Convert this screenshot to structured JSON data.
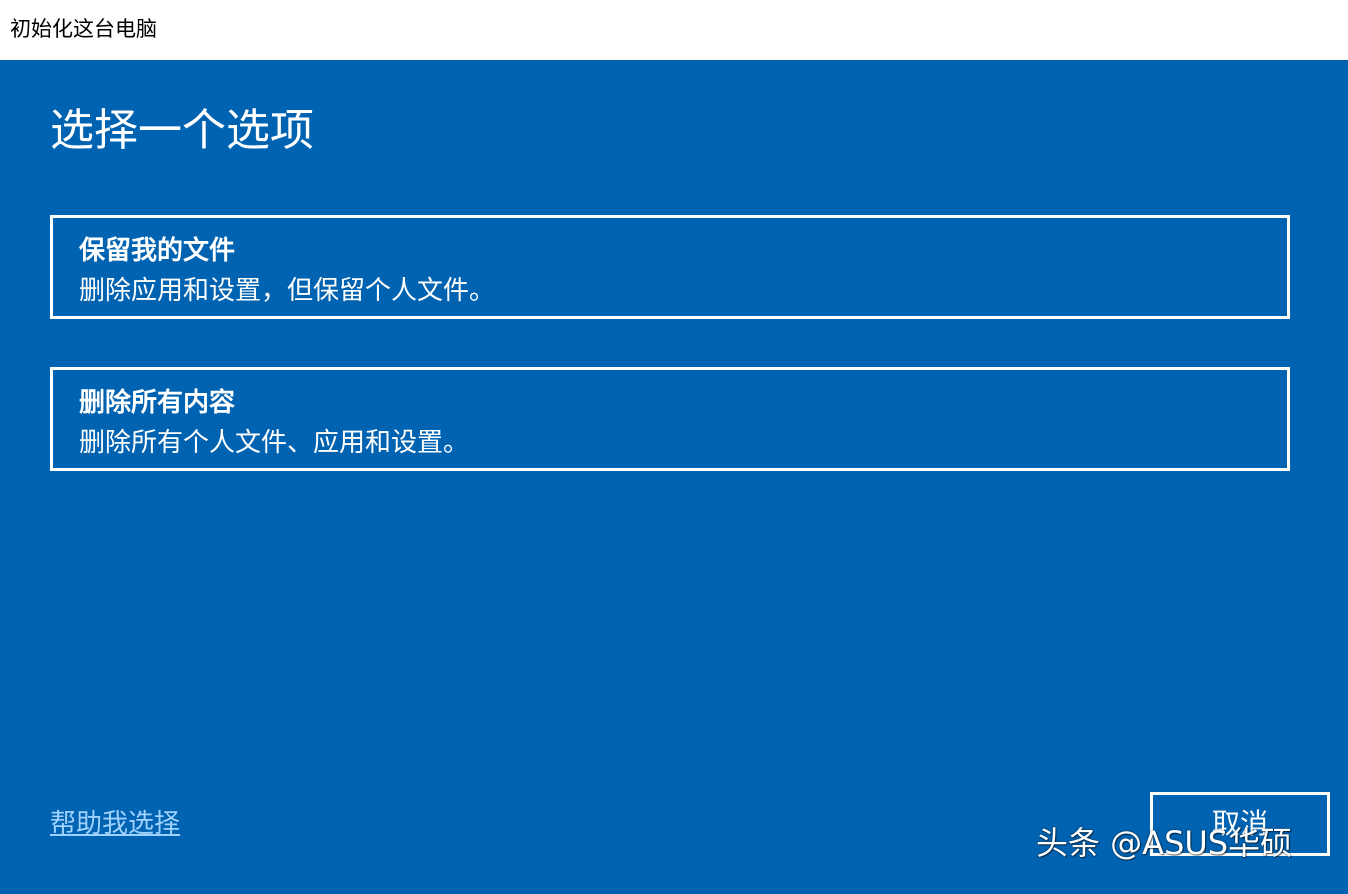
{
  "window": {
    "title": "初始化这台电脑"
  },
  "main": {
    "heading": "选择一个选项",
    "options": [
      {
        "title": "保留我的文件",
        "description": "删除应用和设置，但保留个人文件。"
      },
      {
        "title": "删除所有内容",
        "description": "删除所有个人文件、应用和设置。"
      }
    ],
    "help_link": "帮助我选择",
    "cancel_label": "取消"
  },
  "watermark": "头条 @ASUS华硕",
  "colors": {
    "background": "#0063B1",
    "titlebar": "#FFFFFF",
    "text": "#FFFFFF",
    "link": "#9FD2FF"
  }
}
